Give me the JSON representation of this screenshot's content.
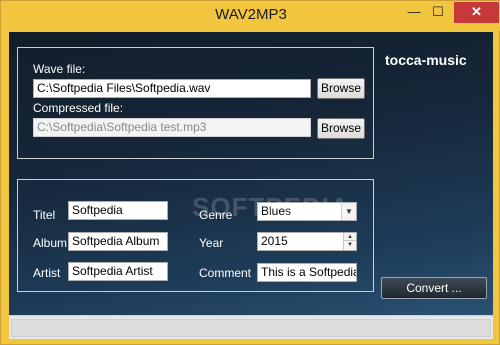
{
  "window": {
    "title": "WAV2MP3",
    "minimize": "—",
    "maximize": "☐",
    "close": "✕"
  },
  "brand": "tocca-music",
  "watermark": "SOFTPEDIA",
  "files": {
    "wave_label": "Wave file:",
    "wave_value": "C:\\Softpedia Files\\Softpedia.wav",
    "compressed_label": "Compressed file:",
    "compressed_value": "C:\\Softpedia\\Softpedia test.mp3",
    "browse_label": "Browse"
  },
  "tags": {
    "titel_label": "Titel",
    "titel_value": "Softpedia",
    "album_label": "Album",
    "album_value": "Softpedia Album",
    "artist_label": "Artist",
    "artist_value": "Softpedia Artist",
    "genre_label": "Genre",
    "genre_value": "Blues",
    "year_label": "Year",
    "year_value": "2015",
    "comment_label": "Comment",
    "comment_value": "This is a Softpedia T"
  },
  "convert_label": "Convert ..."
}
